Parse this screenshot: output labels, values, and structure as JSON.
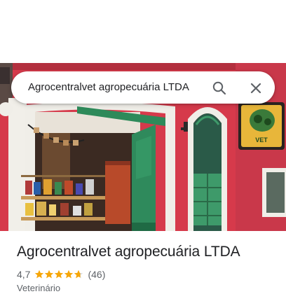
{
  "search": {
    "query": "Agrocentralvet agropecuária LTDA",
    "search_icon": "search-icon",
    "close_icon": "close-icon"
  },
  "photo": {
    "sign_text": "VET",
    "colors": {
      "wall": "#d9394a",
      "door": "#2e8a5a",
      "trim": "#f2f2ee"
    }
  },
  "place": {
    "name": "Agrocentralvet agropecuária LTDA",
    "rating": "4,7",
    "rating_value": 4.7,
    "reviews": "(46)",
    "category": "Veterinário",
    "star_color": "#f6a609"
  }
}
